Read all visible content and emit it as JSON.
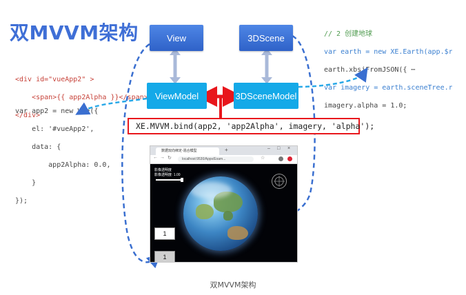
{
  "title": "双MVVM架构",
  "boxes": {
    "view": "View",
    "viewmodel": "ViewModel",
    "scene3d": "3DScene",
    "scenemodel": "3DSceneModel"
  },
  "left_code": {
    "l1": "<div id=\"vueApp2\" >",
    "l2": "    <span>{{ app2Alpha }}</span>",
    "l3": "</div>",
    "l4": "var app2 = new Vue({",
    "l5": "    el: '#vueApp2',",
    "l6": "    data: {",
    "l7": "        app2Alpha: 0.0,",
    "l8": "    }",
    "l9": "});"
  },
  "right_code": {
    "l1": "// 2 创建地球",
    "l2": "var earth = new XE.Earth(app.$r",
    "l3": "earth.xbsjFromJSON({ ⋯",
    "l4": "var imagery = earth.sceneTree.r",
    "l5": "imagery.alpha = 1.0;"
  },
  "bind_code": "XE.MVVM.bind(app2, 'app2Alpha', imagery, 'alpha');",
  "browser": {
    "tab_title": "数据双向绑定-混合模型",
    "url": "localhost:9530/Apps/Exam...",
    "panel_line1": "影像透明度",
    "panel_line2": "影像透明度: 1.00",
    "value_top": "1",
    "value_bottom": "1"
  },
  "caption": "双MVVM架构",
  "colors": {
    "title": "#3f6fd6",
    "box_dark": "#3a6fd8",
    "box_light": "#14a9e8",
    "dashed_arrow": "#3a6fd0",
    "bind_border": "#e8161c",
    "double_arrow": "#a9b9d9"
  }
}
